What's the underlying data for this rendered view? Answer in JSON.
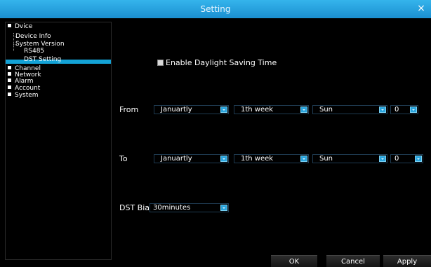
{
  "window": {
    "title": "Setting",
    "close_glyph": "×"
  },
  "tree": {
    "device": "Dvice",
    "device_children": [
      "Device Info",
      "System Version",
      "RS485"
    ],
    "selected": "DST Setting",
    "others": [
      "Channel",
      "Network",
      "Alarm",
      "Account",
      "System"
    ]
  },
  "dst": {
    "enable_label": "Enable Daylight Saving Time",
    "enabled": true,
    "from_label": "From",
    "to_label": "To",
    "bias_label": "DST Bias",
    "from": {
      "month": "Januartly",
      "week": "1th week",
      "day": "Sun",
      "hour": "0"
    },
    "to": {
      "month": "Januartly",
      "week": "1th week",
      "day": "Sun",
      "hour": "0"
    },
    "bias": "30minutes"
  },
  "buttons": {
    "ok": "OK",
    "cancel": "Cancel",
    "apply": "Apply"
  },
  "colors": {
    "title_bar": "#2aa4dc",
    "accent": "#13a2d6",
    "background": "#000000"
  }
}
